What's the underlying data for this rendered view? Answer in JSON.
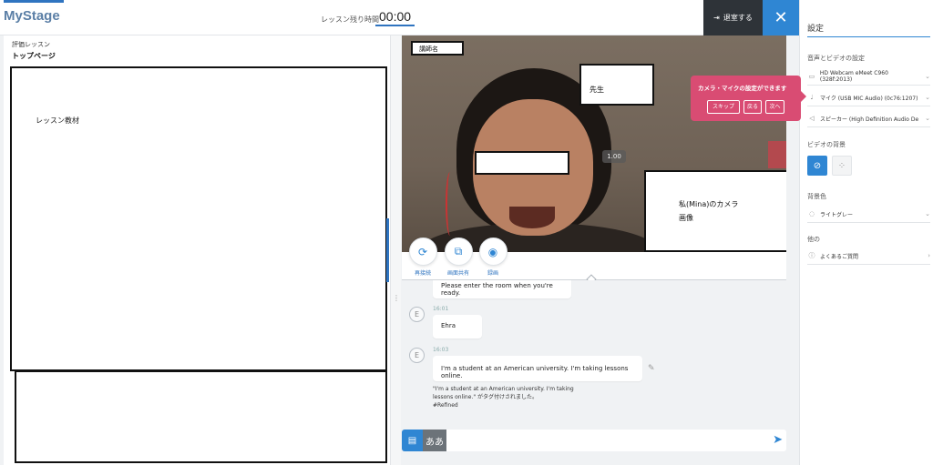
{
  "header": {
    "logo": "MyStage",
    "timer_label": "レッスン残り時間",
    "timer_value": "00:00",
    "exit_label": "退室する",
    "close_symbol": "✕"
  },
  "left": {
    "breadcrumb": "評価レッスン",
    "page_title": "トップページ",
    "material_label": "レッスン教材"
  },
  "video": {
    "name_tag": "講師名",
    "teacher_label": "先生",
    "zoom": "1.00",
    "self_label_line1": "私(Mina)のカメラ",
    "self_label_line2": "画像"
  },
  "controls": {
    "reconnect": "再接続",
    "screen_share": "画面共有",
    "record": "録画"
  },
  "chat": {
    "msg0": "Please enter the room when you're ready.",
    "avatar1": "E",
    "time1": "16:01",
    "msg1": "Ehra",
    "avatar2": "E",
    "time2": "16:03",
    "msg2": "I'm a student at an American university. I'm taking lessons online.",
    "tag_note_line1": "\"I'm a student at an American university. I'm taking",
    "tag_note_line2": "lessons online.\" がタグ付けされました。",
    "tag_note_line3": "#Refined",
    "kana_label": "ああ"
  },
  "settings": {
    "title": "設定",
    "section_av": "音声とビデオの設定",
    "camera": "HD Webcam eMeet C960 (328f:2013)",
    "mic": "マイク (USB MIC Audio) (0c76:1207)",
    "speaker": "スピーカー (High Definition Audio De",
    "section_bg": "ビデオの背景",
    "section_color": "背景色",
    "color_value": "ライトグレー",
    "section_other": "他の",
    "faq": "よくあるご質問"
  },
  "tooltip": {
    "text": "カメラ・マイクの設定ができます",
    "skip": "スキップ",
    "back": "戻る",
    "next": "次へ"
  },
  "colors": {
    "accent": "#2f86d3",
    "tooltip": "#d94c73",
    "dark_button": "#2e3338"
  }
}
